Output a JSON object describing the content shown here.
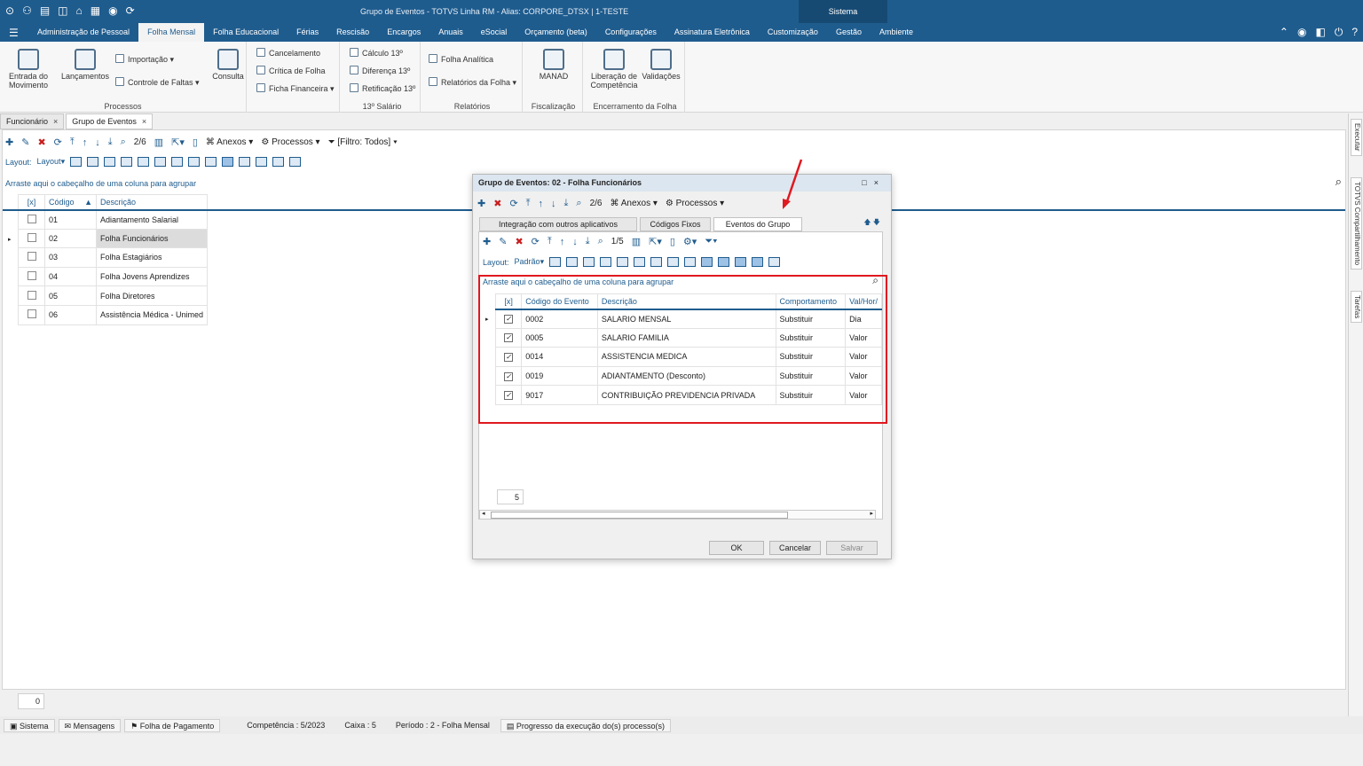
{
  "titlebar": {
    "title": "Grupo de Eventos - TOTVS Linha RM -  Alias: CORPORE_DTSX | 1-TESTE",
    "system": "Sistema"
  },
  "menu": [
    "Administração de Pessoal",
    "Folha Mensal",
    "Folha Educacional",
    "Férias",
    "Rescisão",
    "Encargos",
    "Anuais",
    "eSocial",
    "Orçamento (beta)",
    "Configurações",
    "Assinatura Eletrônica",
    "Customização",
    "Gestão",
    "Ambiente"
  ],
  "menu_active": "Folha Mensal",
  "ribbon": {
    "entrada": "Entrada do Movimento",
    "lancamentos": "Lançamentos",
    "importacao": "Importação",
    "controle_faltas": "Controle de Faltas",
    "consulta": "Consulta",
    "cancelamento": "Cancelamento",
    "critica": "Crítica de Folha",
    "ficha": "Ficha Financeira",
    "calculo13": "Cálculo 13º",
    "diferenca13": "Diferença 13º",
    "retificacao13": "Retificação 13º",
    "folha_analitica": "Folha Analítica",
    "relatorios_folha": "Relatórios da Folha",
    "manad": "MANAD",
    "liberacao": "Liberação de Competência",
    "validacoes": "Validações",
    "grp_processos": "Processos",
    "grp_13": "13º Salário",
    "grp_relatorios": "Relatórios",
    "grp_fiscalizacao": "Fiscalização",
    "grp_encerramento": "Encerramento da Folha"
  },
  "tabs": [
    {
      "label": "Funcionário"
    },
    {
      "label": "Grupo de Eventos"
    }
  ],
  "main_toolbar": {
    "page": "2/6",
    "anexos": "Anexos",
    "processos": "Processos",
    "filtro": "[Filtro: Todos]"
  },
  "layout": {
    "label": "Layout:",
    "value": "Layout"
  },
  "grouphint": "Arraste aqui o cabeçalho de uma coluna para agrupar",
  "main_grid": {
    "headers": [
      "[x]",
      "Código",
      "Descrição"
    ],
    "rows": [
      {
        "codigo": "01",
        "descricao": "Adiantamento Salarial"
      },
      {
        "codigo": "02",
        "descricao": "Folha Funcionários"
      },
      {
        "codigo": "03",
        "descricao": "Folha Estagiários"
      },
      {
        "codigo": "04",
        "descricao": "Folha Jovens Aprendizes"
      },
      {
        "codigo": "05",
        "descricao": "Folha Diretores"
      },
      {
        "codigo": "06",
        "descricao": "Assistência Médica - Unimed"
      }
    ]
  },
  "record_count": "0",
  "dialog": {
    "title": "Grupo de Eventos: 02 - Folha Funcionários",
    "page": "2/6",
    "anexos": "Anexos",
    "processos": "Processos",
    "tabs": [
      "Integração com outros aplicativos",
      "Códigos Fixos",
      "Eventos do Grupo"
    ],
    "inner_page": "1/5",
    "layout_label": "Layout:",
    "layout_value": "Padrão",
    "grouphint": "Arraste aqui o cabeçalho de uma coluna para agrupar",
    "headers": [
      "[x]",
      "Código do Evento",
      "Descrição",
      "Comportamento",
      "Val/Hor/"
    ],
    "rows": [
      {
        "codigo": "0002",
        "descricao": "SALARIO MENSAL",
        "comportamento": "Substituir",
        "val": "Dia"
      },
      {
        "codigo": "0005",
        "descricao": "SALARIO FAMILIA",
        "comportamento": "Substituir",
        "val": "Valor"
      },
      {
        "codigo": "0014",
        "descricao": "ASSISTENCIA MEDICA",
        "comportamento": "Substituir",
        "val": "Valor"
      },
      {
        "codigo": "0019",
        "descricao": "ADIANTAMENTO (Desconto)",
        "comportamento": "Substituir",
        "val": "Valor"
      },
      {
        "codigo": "9017",
        "descricao": "CONTRIBUIÇÃO PREVIDENCIA PRIVADA",
        "comportamento": "Substituir",
        "val": "Valor"
      }
    ],
    "count": "5",
    "ok": "OK",
    "cancelar": "Cancelar",
    "salvar": "Salvar"
  },
  "status": {
    "sistema": "Sistema",
    "mensagens": "Mensagens",
    "folha": "Folha de Pagamento",
    "competencia": "Competência : 5/2023",
    "caixa": "Caixa : 5",
    "periodo": "Período : 2 - Folha Mensal",
    "progresso": "Progresso da execução do(s) processo(s)"
  },
  "side": {
    "executar": "Executar",
    "compart": "TOTVS Compartilhamento",
    "tarefas": "Tarefas"
  },
  "colors": {
    "brand": "#1f5c8e",
    "highlight": "#e0181f"
  }
}
